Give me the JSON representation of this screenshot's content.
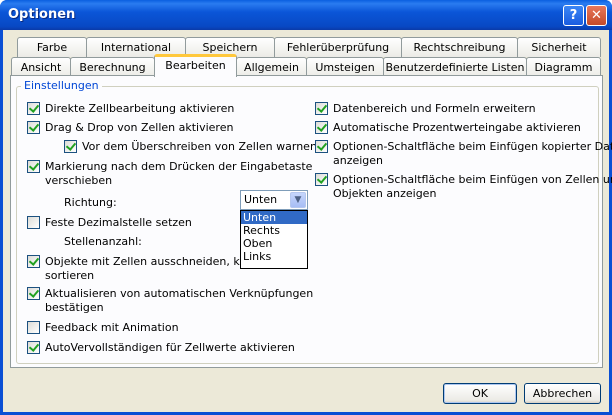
{
  "window": {
    "title": "Optionen",
    "help_label": "?",
    "close_label": "✕"
  },
  "tabs_row1": [
    "Farbe",
    "International",
    "Speichern",
    "Fehlerüberprüfung",
    "Rechtschreibung",
    "Sicherheit"
  ],
  "tabs_row2": [
    "Ansicht",
    "Berechnung",
    "Bearbeiten",
    "Allgemein",
    "Umsteigen",
    "Benutzerdefinierte Listen",
    "Diagramm"
  ],
  "active_tab": "Bearbeiten",
  "group": {
    "label": "Einstellungen"
  },
  "left_options": [
    {
      "label": "Direkte Zellbearbeitung aktivieren",
      "checked": true
    },
    {
      "label": "Drag & Drop von Zellen aktivieren",
      "checked": true
    },
    {
      "label": "Vor dem Überschreiben von Zellen warnen",
      "checked": true
    },
    {
      "label": "Markierung nach dem Drücken der Eingabetaste",
      "label2": "verschieben",
      "checked": true
    },
    {
      "label": "Feste Dezimalstelle setzen",
      "checked": false
    },
    {
      "label": "Objekte mit Zellen ausschneiden, kopieren",
      "label2": "sortieren",
      "checked": true
    },
    {
      "label": "Aktualisieren von automatischen Verknüpfungen",
      "label2": "bestätigen",
      "checked": true
    },
    {
      "label": "Feedback mit Animation",
      "checked": false
    },
    {
      "label": "AutoVervollständigen für Zellwerte aktivieren",
      "checked": true
    }
  ],
  "right_options": [
    {
      "label": "Datenbereich und Formeln erweitern",
      "checked": true
    },
    {
      "label": "Automatische Prozentwerteingabe aktivieren",
      "checked": true
    },
    {
      "label": "Optionen-Schaltfläche beim Einfügen kopierter Daten",
      "label2": "anzeigen",
      "checked": true
    },
    {
      "label": "Optionen-Schaltfläche beim Einfügen von Zellen und",
      "label2": "Objekten anzeigen",
      "checked": true
    }
  ],
  "richtung": {
    "label": "Richtung:",
    "value": "Unten",
    "options": [
      "Unten",
      "Rechts",
      "Oben",
      "Links"
    ]
  },
  "stellenanzahl": {
    "label": "Stellenanzahl:"
  },
  "buttons": {
    "ok": "OK",
    "cancel": "Abbrechen"
  }
}
